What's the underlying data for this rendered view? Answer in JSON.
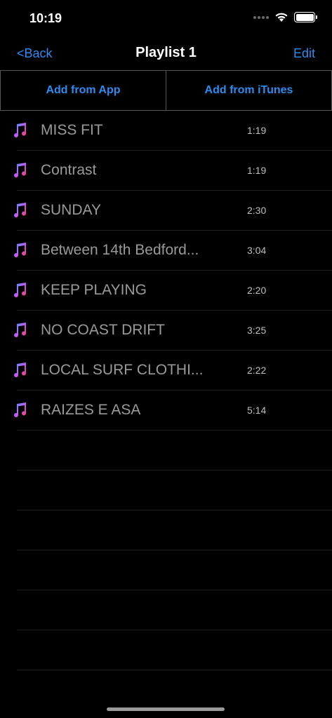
{
  "status": {
    "time": "10:19"
  },
  "nav": {
    "back_label": "<Back",
    "title": "Playlist 1",
    "edit_label": "Edit"
  },
  "add_buttons": {
    "from_app": "Add from App",
    "from_itunes": "Add from iTunes"
  },
  "songs": [
    {
      "title": "MISS FIT",
      "duration": "1:19"
    },
    {
      "title": "Contrast",
      "duration": "1:19"
    },
    {
      "title": "SUNDAY",
      "duration": "2:30"
    },
    {
      "title": "Between 14th Bedford...",
      "duration": "3:04"
    },
    {
      "title": "KEEP PLAYING",
      "duration": "2:20"
    },
    {
      "title": "NO COAST DRIFT",
      "duration": "3:25"
    },
    {
      "title": "LOCAL SURF CLOTHI...",
      "duration": "2:22"
    },
    {
      "title": "RAIZES E ASA",
      "duration": "5:14"
    }
  ],
  "colors": {
    "accent": "#2d8cf0",
    "background": "#000000",
    "title_text": "#9a9a9a"
  },
  "icons": {
    "song": "music-note-icon"
  }
}
